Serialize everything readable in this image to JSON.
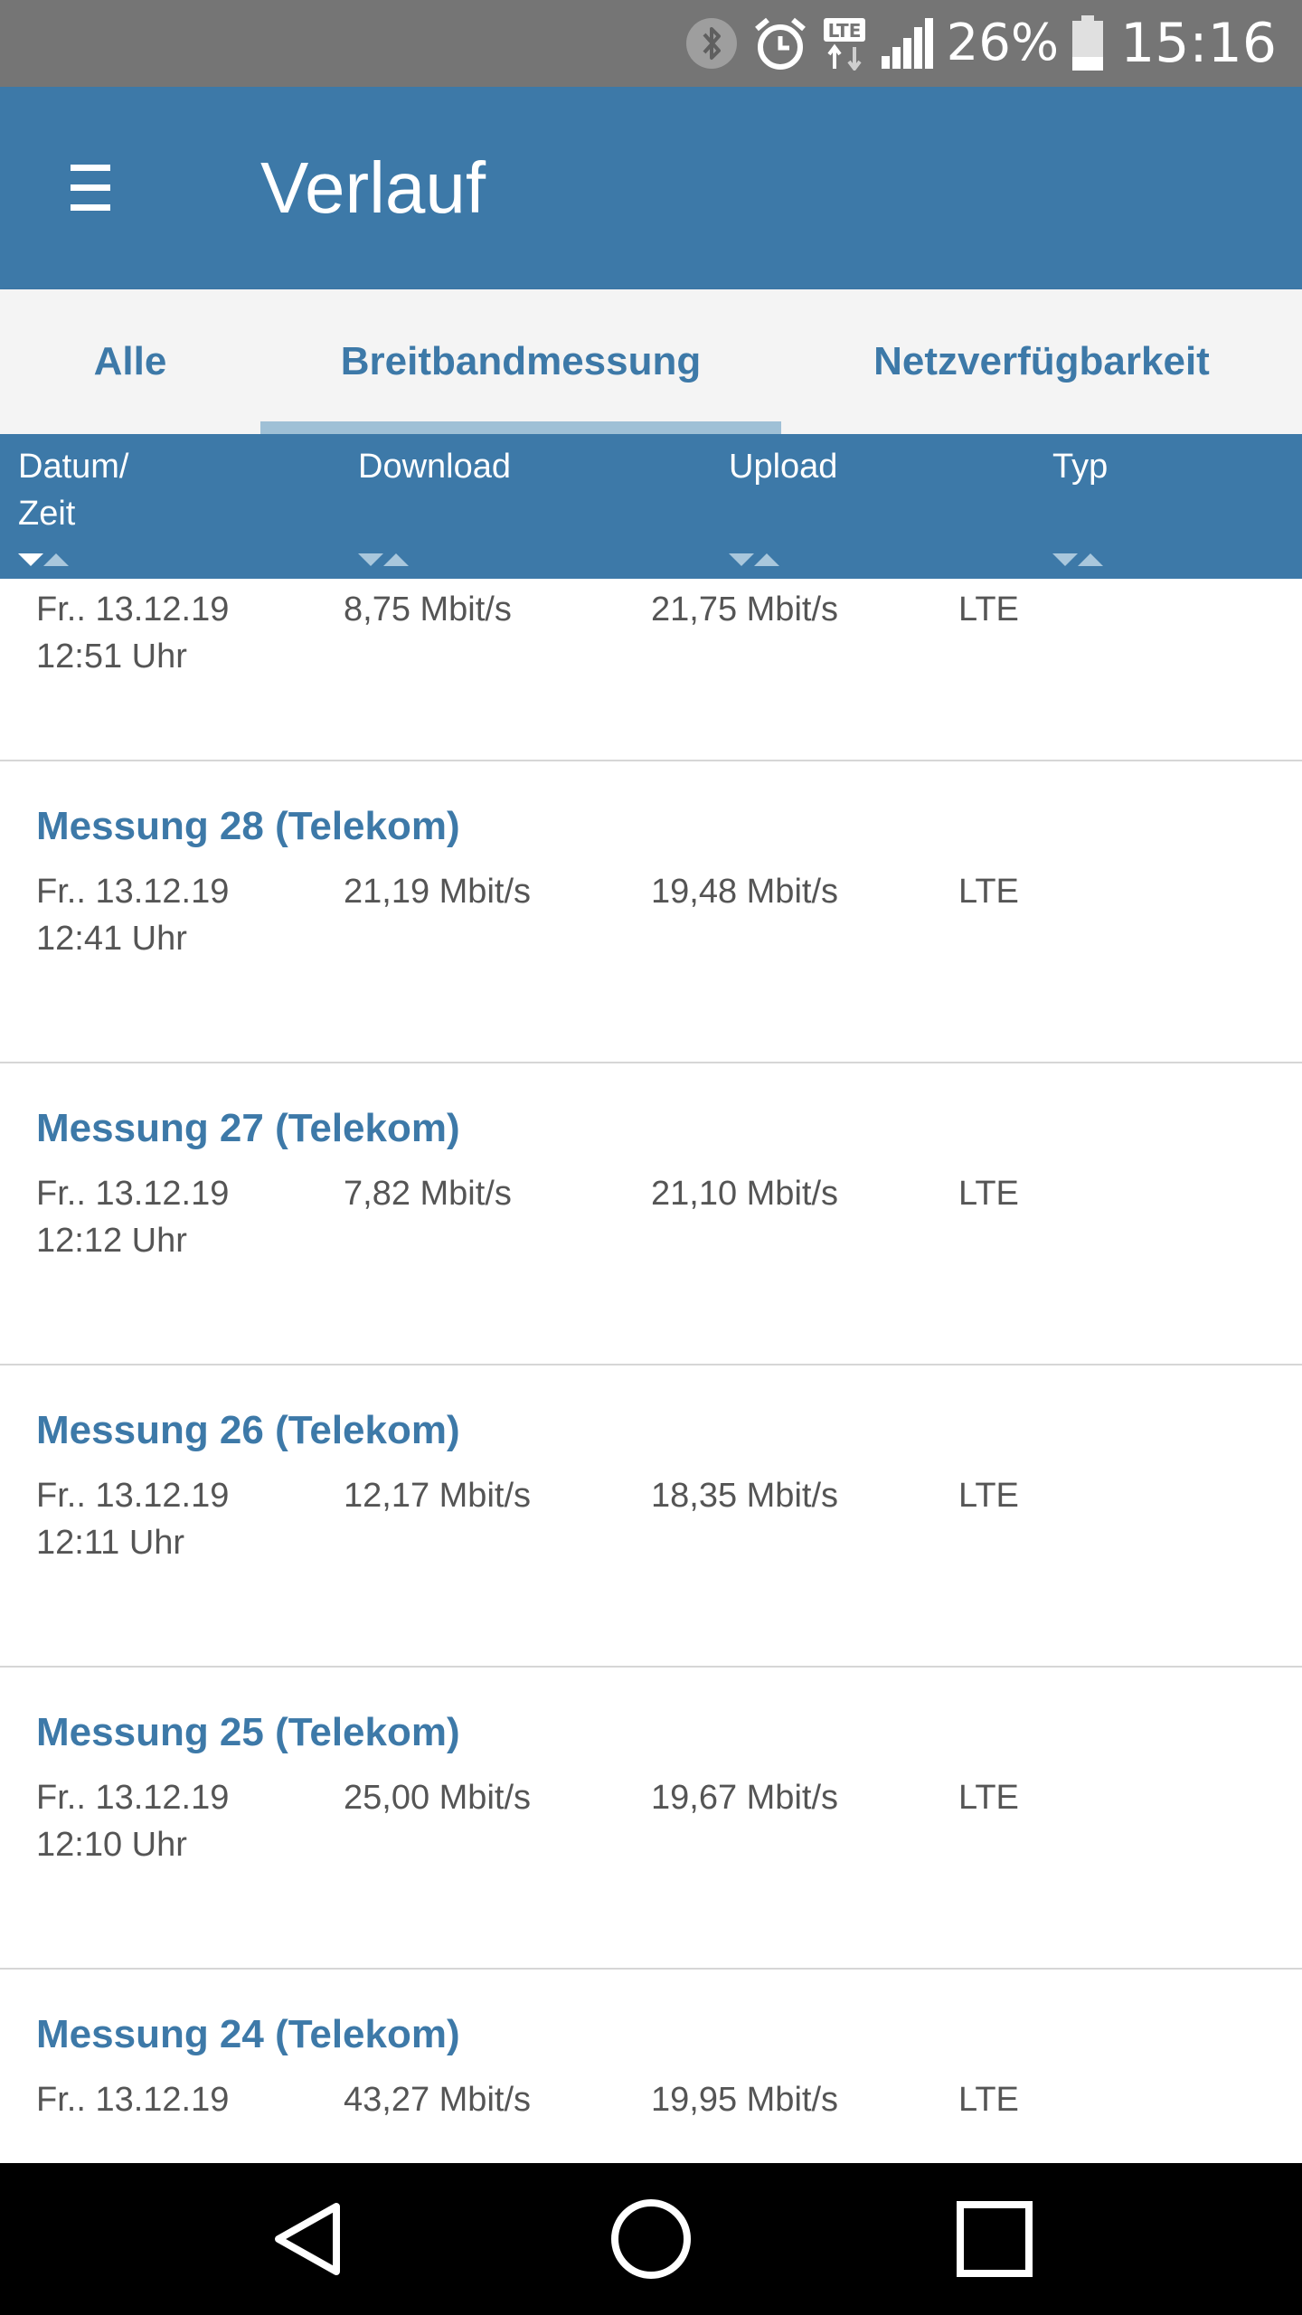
{
  "status_bar": {
    "battery_percent": "26%",
    "time": "15:16",
    "icons": [
      "bluetooth-icon",
      "alarm-icon",
      "lte-data-icon",
      "signal-icon",
      "battery-icon"
    ]
  },
  "app_bar": {
    "title": "Verlauf",
    "menu_icon": "hamburger-menu-icon"
  },
  "tabs": [
    {
      "label": "Alle",
      "active": false
    },
    {
      "label": "Breitbandmessung",
      "active": true
    },
    {
      "label": "Netzverfügbarkeit",
      "active": false
    }
  ],
  "columns": {
    "datetime_line1": "Datum/",
    "datetime_line2": "Zeit",
    "download": "Download",
    "upload": "Upload",
    "type": "Typ"
  },
  "colors": {
    "primary": "#3d79a8",
    "tab_indicator": "#9fc0d6",
    "status_bar": "#757575",
    "text_secondary": "#555555"
  },
  "measurements": [
    {
      "title": "",
      "date": "Fr.. 13.12.19",
      "time": "12:51 Uhr",
      "download": "8,75 Mbit/s",
      "upload": "21,75 Mbit/s",
      "type": "LTE"
    },
    {
      "title": "Messung 28 (Telekom)",
      "date": "Fr.. 13.12.19",
      "time": "12:41 Uhr",
      "download": "21,19 Mbit/s",
      "upload": "19,48 Mbit/s",
      "type": "LTE"
    },
    {
      "title": "Messung 27 (Telekom)",
      "date": "Fr.. 13.12.19",
      "time": "12:12 Uhr",
      "download": "7,82 Mbit/s",
      "upload": "21,10 Mbit/s",
      "type": "LTE"
    },
    {
      "title": "Messung 26 (Telekom)",
      "date": "Fr.. 13.12.19",
      "time": "12:11 Uhr",
      "download": "12,17 Mbit/s",
      "upload": "18,35 Mbit/s",
      "type": "LTE"
    },
    {
      "title": "Messung 25 (Telekom)",
      "date": "Fr.. 13.12.19",
      "time": "12:10 Uhr",
      "download": "25,00 Mbit/s",
      "upload": "19,67 Mbit/s",
      "type": "LTE"
    },
    {
      "title": "Messung 24 (Telekom)",
      "date": "Fr.. 13.12.19",
      "time": "",
      "download": "43,27 Mbit/s",
      "upload": "19,95 Mbit/s",
      "type": "LTE"
    }
  ],
  "nav_bar": [
    "back-icon",
    "home-icon",
    "recents-icon"
  ]
}
